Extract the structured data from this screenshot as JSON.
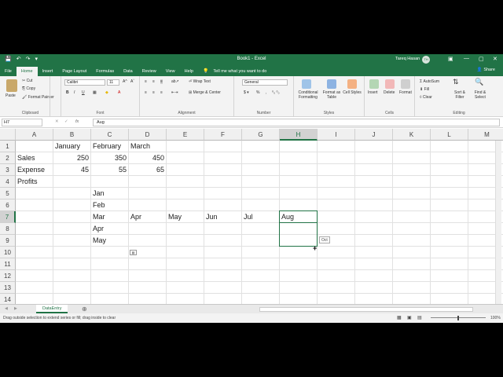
{
  "titlebar": {
    "title": "Book1 - Excel",
    "user": "Tareq Hasan",
    "initials": "TH"
  },
  "tabs": [
    "File",
    "Home",
    "Insert",
    "Page Layout",
    "Formulas",
    "Data",
    "Review",
    "View",
    "Help"
  ],
  "tell_me": "Tell me what you want to do",
  "share": "Share",
  "ribbon": {
    "clipboard": {
      "label": "Clipboard",
      "paste": "Paste",
      "cut": "Cut",
      "copy": "Copy",
      "format_painter": "Format Painter"
    },
    "font": {
      "label": "Font",
      "name": "Calibri",
      "size": "11"
    },
    "alignment": {
      "label": "Alignment",
      "wrap": "Wrap Text",
      "merge": "Merge & Center"
    },
    "number": {
      "label": "Number",
      "format": "General"
    },
    "styles": {
      "label": "Styles",
      "conditional": "Conditional Formatting",
      "format_table": "Format as Table",
      "cell_styles": "Cell Styles"
    },
    "cells": {
      "label": "Cells",
      "insert": "Insert",
      "delete": "Delete",
      "format": "Format"
    },
    "editing": {
      "label": "Editing",
      "autosum": "AutoSum",
      "fill": "Fill",
      "clear": "Clear",
      "sort": "Sort & Filter",
      "find": "Find & Select"
    }
  },
  "formula_bar": {
    "name_box": "H7",
    "fx": "fx",
    "content": "Aug"
  },
  "columns": [
    "A",
    "B",
    "C",
    "D",
    "E",
    "F",
    "G",
    "H",
    "I",
    "J",
    "K",
    "L",
    "M"
  ],
  "rows": [
    "1",
    "2",
    "3",
    "4",
    "5",
    "6",
    "7",
    "8",
    "9",
    "10",
    "11",
    "12",
    "13",
    "14"
  ],
  "cells": {
    "B1": "January",
    "C1": "February",
    "D1": "March",
    "A2": "Sales",
    "B2": "250",
    "C2": "350",
    "D2": "450",
    "A3": "Expense",
    "B3": "45",
    "C3": "55",
    "D3": "65",
    "A4": "Profits",
    "C5": "Jan",
    "C6": "Feb",
    "C7": "Mar",
    "D7": "Apr",
    "E7": "May",
    "F7": "Jun",
    "G7": "Jul",
    "H7": "Aug",
    "C8": "Apr",
    "C9": "May"
  },
  "fill_tooltip": "Oct",
  "sheet_tab": "DataEntry",
  "status": {
    "message": "Drag outside selection to extend series or fill; drag inside to clear",
    "zoom": "100%"
  },
  "colors": {
    "accent": "#217346"
  }
}
